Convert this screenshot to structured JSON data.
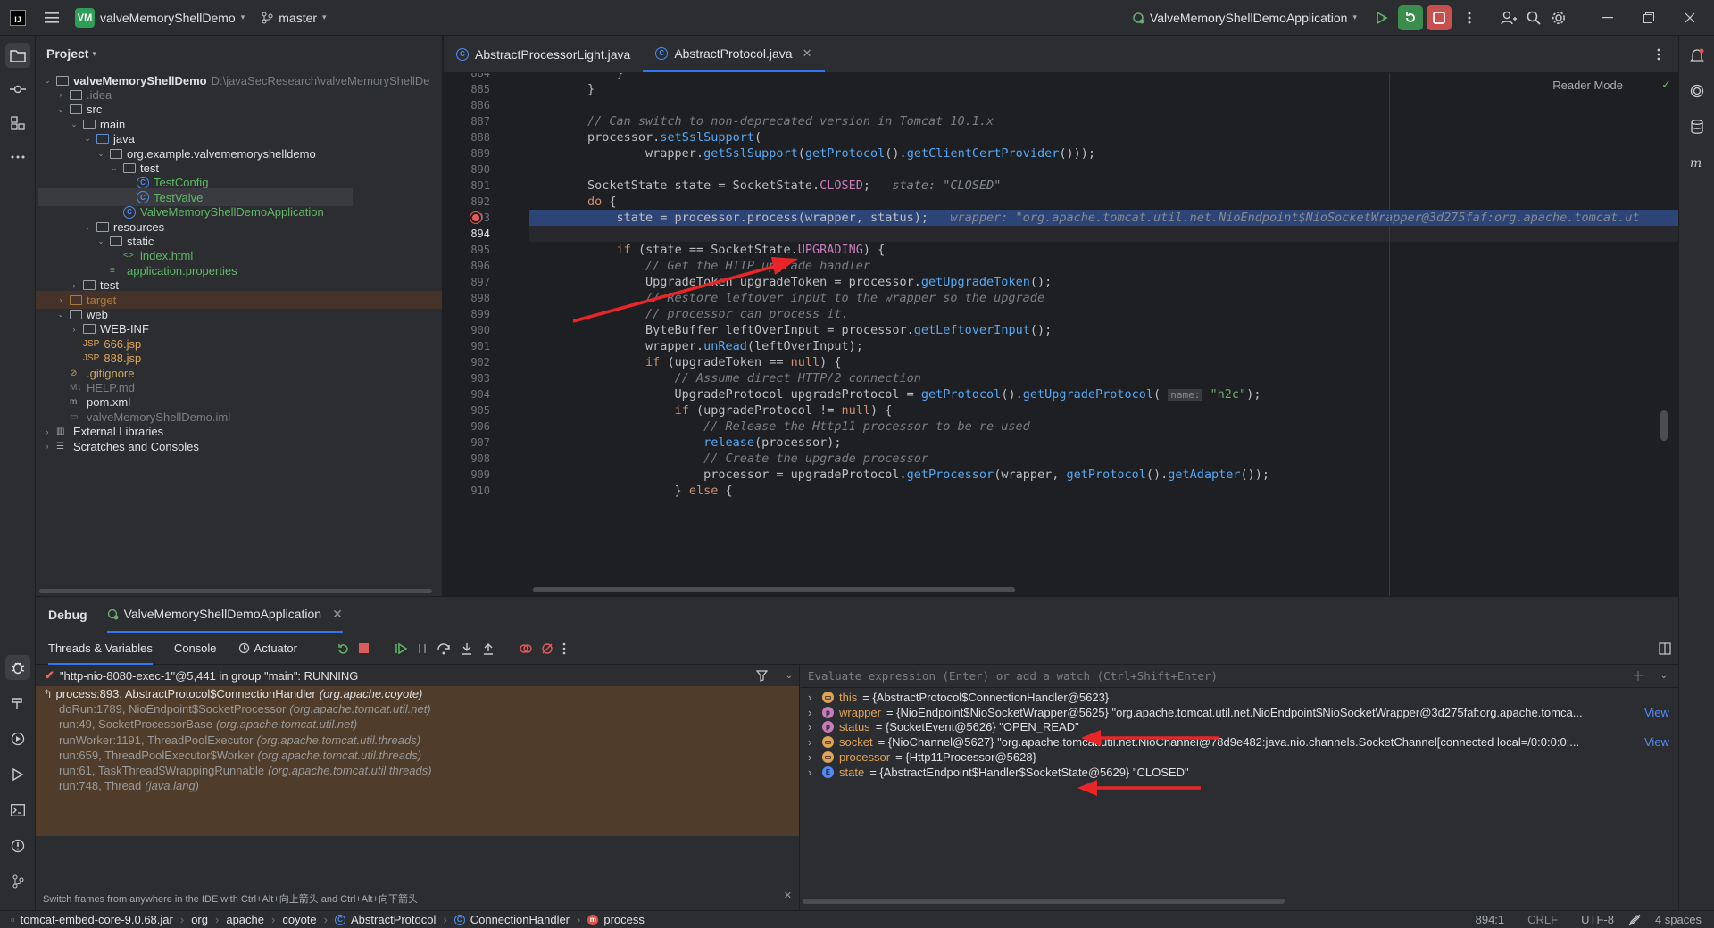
{
  "titlebar": {
    "project_badge": "VM",
    "project_name": "valveMemoryShellDemo",
    "branch": "master",
    "run_config": "ValveMemoryShellDemoApplication"
  },
  "project_panel": {
    "title": "Project",
    "tree": [
      {
        "label": "valveMemoryShellDemo",
        "extra": "D:\\javaSecResearch\\valveMemoryShellDe",
        "kind": "module"
      },
      {
        "label": ".idea",
        "kind": "folder-dim"
      },
      {
        "label": "src",
        "kind": "folder"
      },
      {
        "label": "main",
        "kind": "folder"
      },
      {
        "label": "java",
        "kind": "folder-blue"
      },
      {
        "label": "org.example.valvememoryshelldemo",
        "kind": "package"
      },
      {
        "label": "test",
        "kind": "package"
      },
      {
        "label": "TestConfig",
        "kind": "class"
      },
      {
        "label": "TestValve",
        "kind": "class"
      },
      {
        "label": "ValveMemoryShellDemoApplication",
        "kind": "class-app"
      },
      {
        "label": "resources",
        "kind": "folder-res"
      },
      {
        "label": "static",
        "kind": "folder"
      },
      {
        "label": "index.html",
        "kind": "html"
      },
      {
        "label": "application.properties",
        "kind": "props"
      },
      {
        "label": "test",
        "kind": "folder"
      },
      {
        "label": "target",
        "kind": "folder-excluded"
      },
      {
        "label": "web",
        "kind": "folder"
      },
      {
        "label": "WEB-INF",
        "kind": "folder"
      },
      {
        "label": "666.jsp",
        "kind": "jsp"
      },
      {
        "label": "888.jsp",
        "kind": "jsp"
      },
      {
        "label": ".gitignore",
        "kind": "gitignore"
      },
      {
        "label": "HELP.md",
        "kind": "md"
      },
      {
        "label": "pom.xml",
        "kind": "maven"
      },
      {
        "label": "valveMemoryShellDemo.iml",
        "kind": "iml"
      },
      {
        "label": "External Libraries",
        "kind": "libs"
      },
      {
        "label": "Scratches and Consoles",
        "kind": "scratch"
      }
    ]
  },
  "editor": {
    "tabs": [
      {
        "label": "AbstractProcessorLight.java",
        "active": false
      },
      {
        "label": "AbstractProtocol.java",
        "active": true
      }
    ],
    "reader_mode": "Reader Mode",
    "lines": [
      {
        "n": "884",
        "html": "            }"
      },
      {
        "n": "885",
        "html": "        }"
      },
      {
        "n": "886",
        "html": ""
      },
      {
        "n": "887",
        "html": "<span class='cm'>        // Can switch to non-deprecated version in Tomcat 10.1.x</span>"
      },
      {
        "n": "888",
        "html": "        processor.<span class='fn'>setSslSupport</span>("
      },
      {
        "n": "889",
        "html": "                wrapper.<span class='fn'>getSslSupport</span>(<span class='fn'>getProtocol</span>().<span class='fn'>getClientCertProvider</span>()));"
      },
      {
        "n": "890",
        "html": ""
      },
      {
        "n": "891",
        "html": "        SocketState state = SocketState.<span class='cst'>CLOSED</span>;  <span class='inlay'> state: \"CLOSED\"</span>"
      },
      {
        "n": "892",
        "html": "        <span class='kw'>do</span> {"
      },
      {
        "n": "893",
        "html": "            state = processor.process(wrapper, status);  <span class='inlay'> wrapper: \"org.apache.tomcat.util.net.NioEndpoint$NioSocketWrapper@3d275faf:org.apache.tomcat.ut</span>"
      },
      {
        "n": "894",
        "html": ""
      },
      {
        "n": "895",
        "html": "            <span class='kw'>if</span> (state == SocketState.<span class='cst'>UPGRADING</span>) {"
      },
      {
        "n": "896",
        "html": "<span class='cm'>                // Get the HTTP upgrade handler</span>"
      },
      {
        "n": "897",
        "html": "                UpgradeToken upgradeToken = processor.<span class='fn'>getUpgradeToken</span>();"
      },
      {
        "n": "898",
        "html": "<span class='cm'>                // Restore leftover input to the wrapper so the upgrade</span>"
      },
      {
        "n": "899",
        "html": "<span class='cm'>                // processor can process it.</span>"
      },
      {
        "n": "900",
        "html": "                ByteBuffer leftOverInput = processor.<span class='fn'>getLeftoverInput</span>();"
      },
      {
        "n": "901",
        "html": "                wrapper.<span class='fn'>unRead</span>(leftOverInput);"
      },
      {
        "n": "902",
        "html": "                <span class='kw'>if</span> (upgradeToken == <span class='kw'>null</span>) {"
      },
      {
        "n": "903",
        "html": "<span class='cm'>                    // Assume direct HTTP/2 connection</span>"
      },
      {
        "n": "904",
        "html": "                    UpgradeProtocol upgradeProtocol = <span class='fn'>getProtocol</span>().<span class='fn'>getUpgradeProtocol</span>( <span class='inlay' style='background:#393b40;font-style:normal;font-size:11px;padding:0 3px'>name:</span> <span class='str'>\"h2c\"</span>);"
      },
      {
        "n": "905",
        "html": "                    <span class='kw'>if</span> (upgradeProtocol != <span class='kw'>null</span>) {"
      },
      {
        "n": "906",
        "html": "<span class='cm'>                        // Release the Http11 processor to be re-used</span>"
      },
      {
        "n": "907",
        "html": "                        <span class='fn'>release</span>(processor);"
      },
      {
        "n": "908",
        "html": "<span class='cm'>                        // Create the upgrade processor</span>"
      },
      {
        "n": "909",
        "html": "                        processor = upgradeProtocol.<span class='fn'>getProcessor</span>(wrapper, <span class='fn'>getProtocol</span>().<span class='fn'>getAdapter</span>());"
      },
      {
        "n": "910",
        "html": "                    } <span class='kw'>else</span> {"
      }
    ]
  },
  "debug": {
    "tab_debug": "Debug",
    "tab_session": "ValveMemoryShellDemoApplication",
    "subtabs": [
      "Threads & Variables",
      "Console",
      "Actuator"
    ],
    "thread": "\"http-nio-8080-exec-1\"@5,441 in group \"main\": RUNNING",
    "frames": [
      {
        "method": "process:893, AbstractProtocol$ConnectionHandler",
        "pkg": "(org.apache.coyote)",
        "current": true
      },
      {
        "method": "doRun:1789, NioEndpoint$SocketProcessor",
        "pkg": "(org.apache.tomcat.util.net)"
      },
      {
        "method": "run:49, SocketProcessorBase",
        "pkg": "(org.apache.tomcat.util.net)"
      },
      {
        "method": "runWorker:1191, ThreadPoolExecutor",
        "pkg": "(org.apache.tomcat.util.threads)"
      },
      {
        "method": "run:659, ThreadPoolExecutor$Worker",
        "pkg": "(org.apache.tomcat.util.threads)"
      },
      {
        "method": "run:61, TaskThread$WrappingRunnable",
        "pkg": "(org.apache.tomcat.util.threads)"
      },
      {
        "method": "run:748, Thread",
        "pkg": "(java.lang)"
      }
    ],
    "hint": "Switch frames from anywhere in the IDE with Ctrl+Alt+向上箭头 and Ctrl+Alt+向下箭头",
    "eval_placeholder": "Evaluate expression (Enter) or add a watch (Ctrl+Shift+Enter)",
    "variables": [
      {
        "name": "this",
        "value": "= {AbstractProtocol$ConnectionHandler@5623}",
        "icon": "field",
        "view": ""
      },
      {
        "name": "wrapper",
        "value": "= {NioEndpoint$NioSocketWrapper@5625} \"org.apache.tomcat.util.net.NioEndpoint$NioSocketWrapper@3d275faf:org.apache.tomca...",
        "icon": "param",
        "view": "View"
      },
      {
        "name": "status",
        "value": "= {SocketEvent@5626} \"OPEN_READ\"",
        "icon": "param",
        "view": ""
      },
      {
        "name": "socket",
        "value": "= {NioChannel@5627} \"org.apache.tomcat.util.net.NioChannel@78d9e482:java.nio.channels.SocketChannel[connected local=/0:0:0:0:...",
        "icon": "field",
        "view": "View"
      },
      {
        "name": "processor",
        "value": "= {Http11Processor@5628}",
        "icon": "field",
        "view": ""
      },
      {
        "name": "state",
        "value": "= {AbstractEndpoint$Handler$SocketState@5629} \"CLOSED\"",
        "icon": "enum",
        "view": ""
      }
    ]
  },
  "statusbar": {
    "crumbs": [
      "tomcat-embed-core-9.0.68.jar",
      "org",
      "apache",
      "coyote",
      "AbstractProtocol",
      "ConnectionHandler",
      "process"
    ],
    "position": "894:1",
    "line_sep": "CRLF",
    "encoding": "UTF-8",
    "indent": "4 spaces"
  },
  "colors": {
    "accent": "#3574f0",
    "exec_line": "#2d4476",
    "annotation": "#e8262a"
  }
}
